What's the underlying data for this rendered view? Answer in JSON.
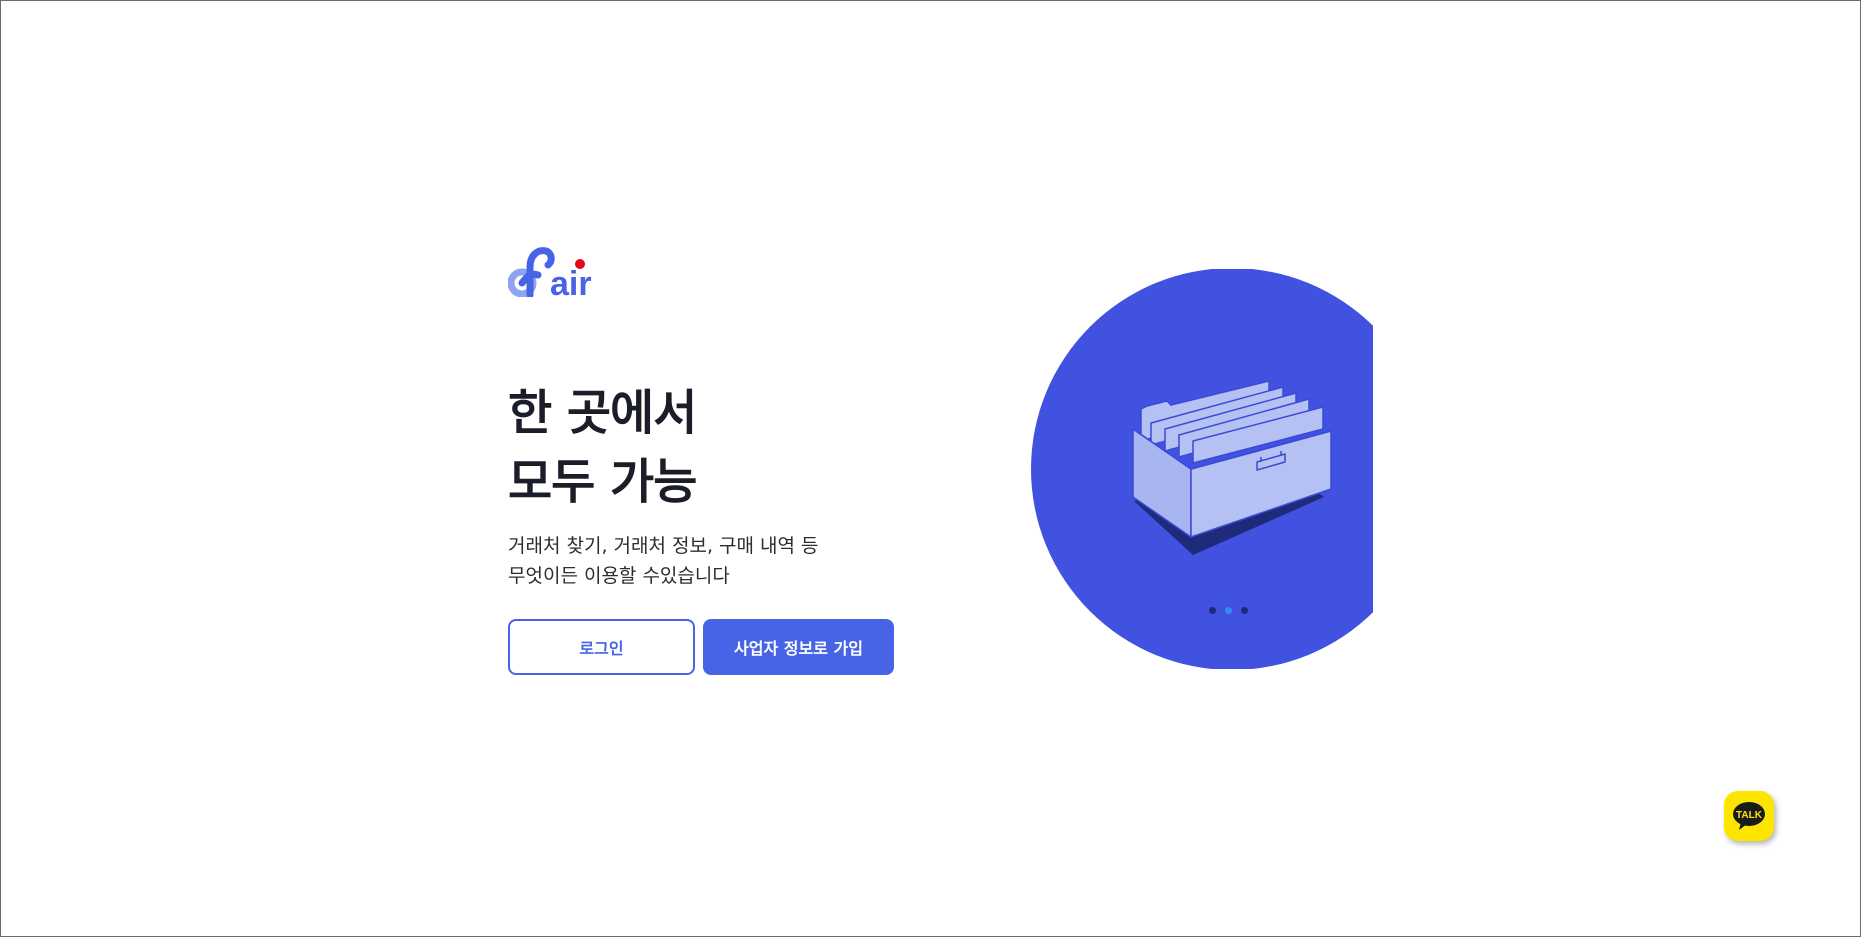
{
  "brand": {
    "logo_text": "air",
    "accent": "#4764e6",
    "dot_color": "#e30613"
  },
  "hero": {
    "headline_line1": "한 곳에서",
    "headline_line2": "모두 가능",
    "desc_line1": "거래처 찾기, 거래처 정보, 구매 내역 등",
    "desc_line2": "무엇이든 이용할 수있습니다"
  },
  "buttons": {
    "login_label": "로그인",
    "signup_label": "사업자 정보로 가입"
  },
  "carousel": {
    "slide_count": 3,
    "active_index": 1,
    "illustration_icon": "file-drawer-icon",
    "background_color": "#4152e0"
  },
  "floating": {
    "talk_label": "TALK",
    "talk_color": "#fee500",
    "icon": "kakao-talk-icon"
  }
}
